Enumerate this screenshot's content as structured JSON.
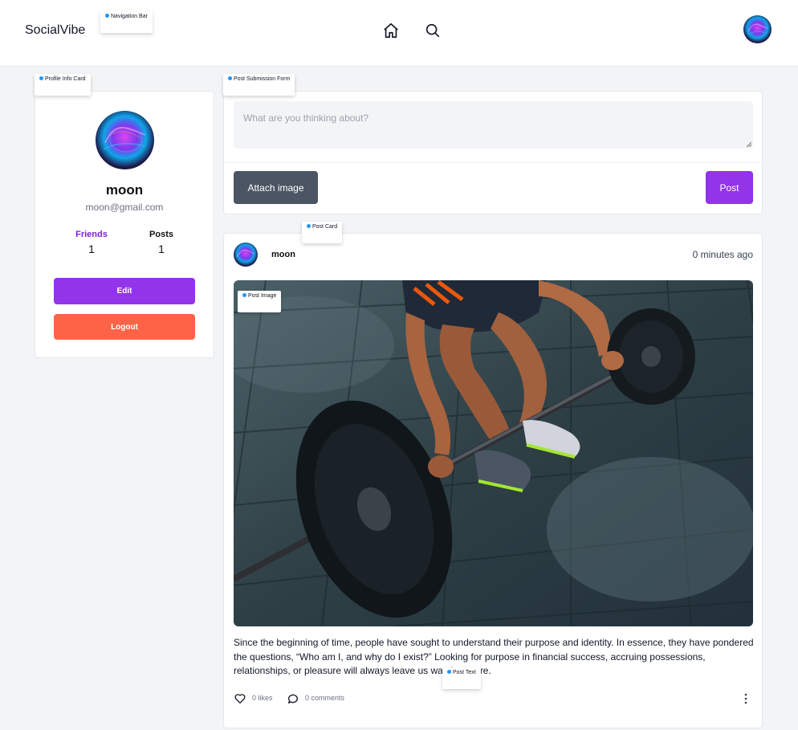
{
  "nav": {
    "brand": "SocialVibe",
    "home_icon": "home-icon",
    "search_icon": "search-icon",
    "avatar_icon": "user-avatar"
  },
  "tags": {
    "navigation_bar": "Navigation Bar",
    "profile_info_card": "Profile Info Card",
    "post_submission_form": "Post Submission Form",
    "post_card": "Post Card",
    "post_image": "Post Image",
    "post_text": "Post Text"
  },
  "profile": {
    "name": "moon",
    "email": "moon@gmail.com",
    "friends_label": "Friends",
    "friends_count": "1",
    "posts_label": "Posts",
    "posts_count": "1",
    "edit_label": "Edit",
    "logout_label": "Logout"
  },
  "post_form": {
    "placeholder": "What are you thinking about?",
    "attach_label": "Attach image",
    "post_label": "Post"
  },
  "post": {
    "author": "moon",
    "time": "0 minutes ago",
    "image_description_icon": "weightlifting-photo",
    "text": "Since the beginning of time, people have sought to understand their purpose and identity. In essence, they have pondered the questions, “Who am I, and why do I exist?” Looking for purpose in financial success, accruing possessions, relationships, or pleasure will always leave us wanting more.",
    "likes": "0 likes",
    "comments": "0 comments",
    "like_icon": "heart-icon",
    "comment_icon": "comment-icon",
    "more_icon": "more-vertical-icon"
  },
  "colors": {
    "accent": "#9333ea",
    "logout": "#ff6347",
    "attach": "#4b5563",
    "background": "#f3f4f6"
  }
}
